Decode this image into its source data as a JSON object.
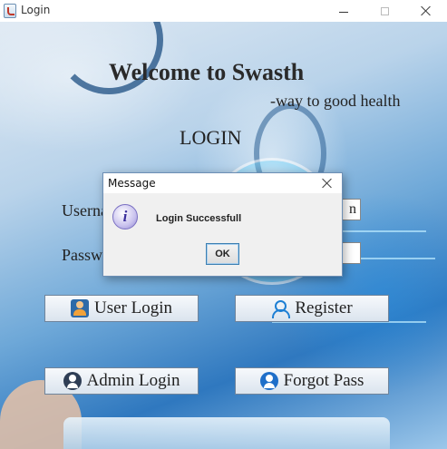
{
  "window": {
    "title": "Login",
    "app_icon": "java-cup-icon"
  },
  "header": {
    "welcome_title": "Welcome to Swasth",
    "tagline": "-way to good health",
    "login_heading": "LOGIN"
  },
  "form": {
    "username_label": "Username",
    "password_label": "Password",
    "username_value": "n",
    "password_value": ""
  },
  "buttons": {
    "user_login": "User Login",
    "register": "Register",
    "admin_login": "Admin Login",
    "forgot_pass": "Forgot Pass"
  },
  "dialog": {
    "title": "Message",
    "message": "Login Successfull",
    "ok_label": "OK",
    "icon": "info-icon",
    "info_glyph": "i"
  },
  "colors": {
    "dialog_border": "#6d8fb5",
    "button_border": "#6f849b",
    "ok_focus_border": "#3c7fb1",
    "background_blue": "#2f78bf"
  }
}
